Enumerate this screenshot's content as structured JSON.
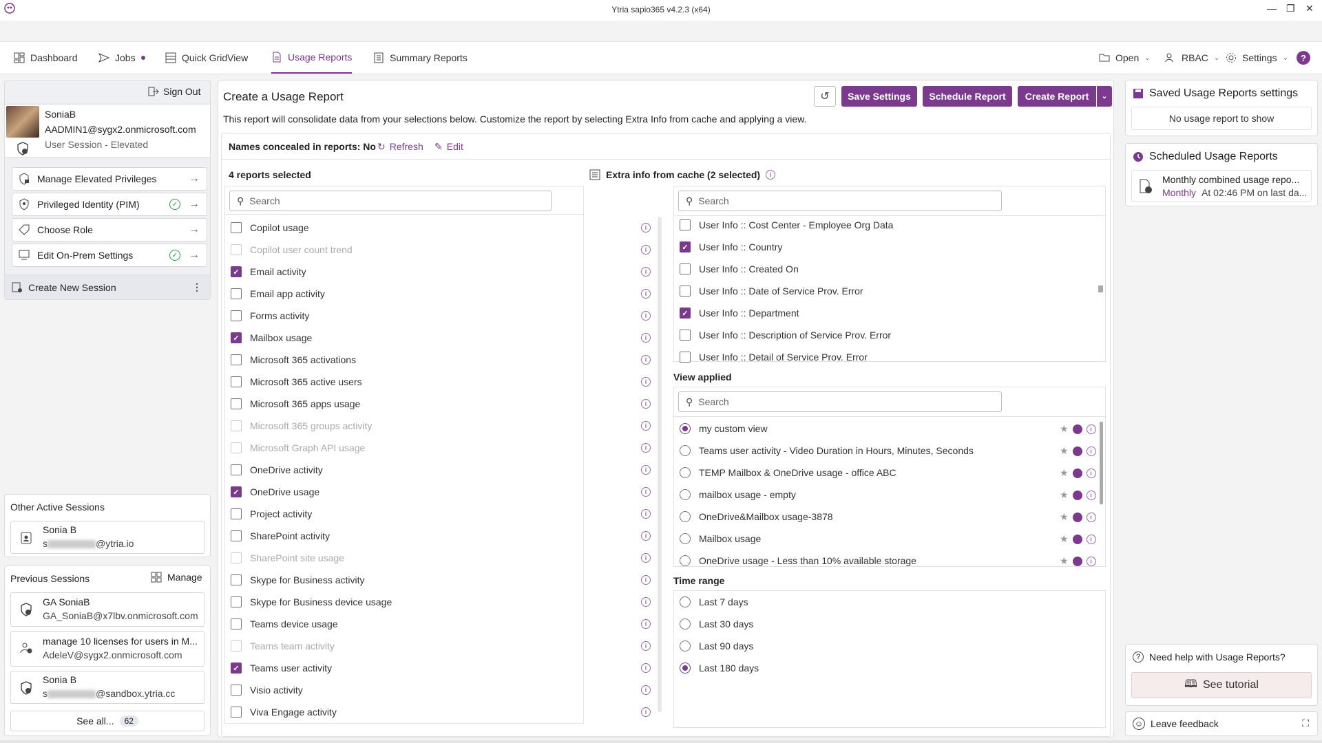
{
  "window": {
    "title": "Ytria sapio365 v4.2.3 (x64)"
  },
  "nav": {
    "tabs": [
      {
        "label": "Dashboard"
      },
      {
        "label": "Jobs"
      },
      {
        "label": "Quick GridView"
      },
      {
        "label": "Usage Reports"
      },
      {
        "label": "Summary Reports"
      }
    ],
    "open_label": "Open",
    "rbac_label": "RBAC",
    "settings_label": "Settings"
  },
  "session": {
    "sign_out": "Sign Out",
    "name": "SoniaB",
    "email": "AADMIN1@sygx2.onmicrosoft.com",
    "type": "User Session - Elevated",
    "actions": [
      {
        "label": "Manage Elevated Privileges"
      },
      {
        "label": "Privileged Identity (PIM)"
      },
      {
        "label": "Choose Role"
      },
      {
        "label": "Edit On-Prem Settings"
      }
    ],
    "create_new": "Create New Session"
  },
  "other_sessions": {
    "title": "Other Active Sessions",
    "items": [
      {
        "name": "Sonia B",
        "email_prefix": "s",
        "email_suffix": "@ytria.io"
      }
    ]
  },
  "previous_sessions": {
    "title": "Previous Sessions",
    "manage": "Manage",
    "items": [
      {
        "name": "GA SoniaB",
        "email": "GA_SoniaB@x7lbv.onmicrosoft.com"
      },
      {
        "name": "manage 10 licenses for users in M...",
        "email": "AdeleV@sygx2.onmicrosoft.com"
      },
      {
        "name": "Sonia B",
        "email_prefix": "s",
        "email_suffix": "@sandbox.ytria.cc"
      }
    ],
    "see_all": "See all...",
    "count": "62"
  },
  "main": {
    "title": "Create a Usage Report",
    "save_settings": "Save Settings",
    "schedule_report": "Schedule Report",
    "create_report": "Create Report",
    "description": "This report will consolidate data from your selections below. Customize the report by selecting Extra Info from cache and applying a view.",
    "names_concealed": "Names concealed in reports: No",
    "refresh": "Refresh",
    "edit": "Edit",
    "reports_selected": "4 reports selected",
    "search_placeholder": "Search",
    "reports": [
      {
        "label": "Copilot usage",
        "checked": false,
        "disabled": false
      },
      {
        "label": "Copilot user count trend",
        "checked": false,
        "disabled": true
      },
      {
        "label": "Email activity",
        "checked": true,
        "disabled": false
      },
      {
        "label": "Email app activity",
        "checked": false,
        "disabled": false
      },
      {
        "label": "Forms activity",
        "checked": false,
        "disabled": false
      },
      {
        "label": "Mailbox usage",
        "checked": true,
        "disabled": false
      },
      {
        "label": "Microsoft 365 activations",
        "checked": false,
        "disabled": false
      },
      {
        "label": "Microsoft 365 active users",
        "checked": false,
        "disabled": false
      },
      {
        "label": "Microsoft 365 apps usage",
        "checked": false,
        "disabled": false
      },
      {
        "label": "Microsoft 365 groups activity",
        "checked": false,
        "disabled": true
      },
      {
        "label": "Microsoft Graph API usage",
        "checked": false,
        "disabled": true
      },
      {
        "label": "OneDrive activity",
        "checked": false,
        "disabled": false
      },
      {
        "label": "OneDrive usage",
        "checked": true,
        "disabled": false
      },
      {
        "label": "Project activity",
        "checked": false,
        "disabled": false
      },
      {
        "label": "SharePoint activity",
        "checked": false,
        "disabled": false
      },
      {
        "label": "SharePoint site usage",
        "checked": false,
        "disabled": true
      },
      {
        "label": "Skype for Business activity",
        "checked": false,
        "disabled": false
      },
      {
        "label": "Skype for Business device usage",
        "checked": false,
        "disabled": false
      },
      {
        "label": "Teams device usage",
        "checked": false,
        "disabled": false
      },
      {
        "label": "Teams team activity",
        "checked": false,
        "disabled": true
      },
      {
        "label": "Teams user activity",
        "checked": true,
        "disabled": false
      },
      {
        "label": "Visio activity",
        "checked": false,
        "disabled": false
      },
      {
        "label": "Viva Engage activity",
        "checked": false,
        "disabled": false
      }
    ],
    "extra_info_title": "Extra info from cache (2 selected)",
    "extra_info": [
      {
        "label": "User Info :: Cost Center - Employee Org Data",
        "checked": false
      },
      {
        "label": "User Info :: Country",
        "checked": true
      },
      {
        "label": "User Info :: Created On",
        "checked": false
      },
      {
        "label": "User Info :: Date of Service Prov. Error",
        "checked": false
      },
      {
        "label": "User Info :: Department",
        "checked": true
      },
      {
        "label": "User Info :: Description of Service Prov. Error",
        "checked": false
      },
      {
        "label": "User Info :: Detail of Service Prov. Error",
        "checked": false
      }
    ],
    "view_applied_title": "View applied",
    "views": [
      {
        "label": "my custom view",
        "selected": true
      },
      {
        "label": "Teams user activity - Video Duration in Hours, Minutes, Seconds",
        "selected": false
      },
      {
        "label": "TEMP Mailbox & OneDrive usage - office ABC",
        "selected": false
      },
      {
        "label": "mailbox usage - empty",
        "selected": false
      },
      {
        "label": "OneDrive&Mailbox usage-3878",
        "selected": false
      },
      {
        "label": "Mailbox usage",
        "selected": false
      },
      {
        "label": "OneDrive usage - Less than 10% available storage",
        "selected": false
      }
    ],
    "time_range_title": "Time range",
    "time_ranges": [
      {
        "label": "Last 7 days",
        "selected": false
      },
      {
        "label": "Last 30 days",
        "selected": false
      },
      {
        "label": "Last 90 days",
        "selected": false
      },
      {
        "label": "Last 180 days",
        "selected": true
      }
    ]
  },
  "right": {
    "saved_title": "Saved Usage Reports settings",
    "saved_empty": "No usage report to show",
    "scheduled_title": "Scheduled Usage Reports",
    "scheduled_item_title": "Monthly combined usage repo...",
    "scheduled_item_freq": "Monthly",
    "scheduled_item_detail": "At 02:46 PM on last da...",
    "help_text": "Need help with Usage Reports?",
    "tutorial": "See tutorial",
    "feedback": "Leave feedback"
  },
  "colors": {
    "accent": "#7b3a8e",
    "success": "#2a9d4a"
  }
}
